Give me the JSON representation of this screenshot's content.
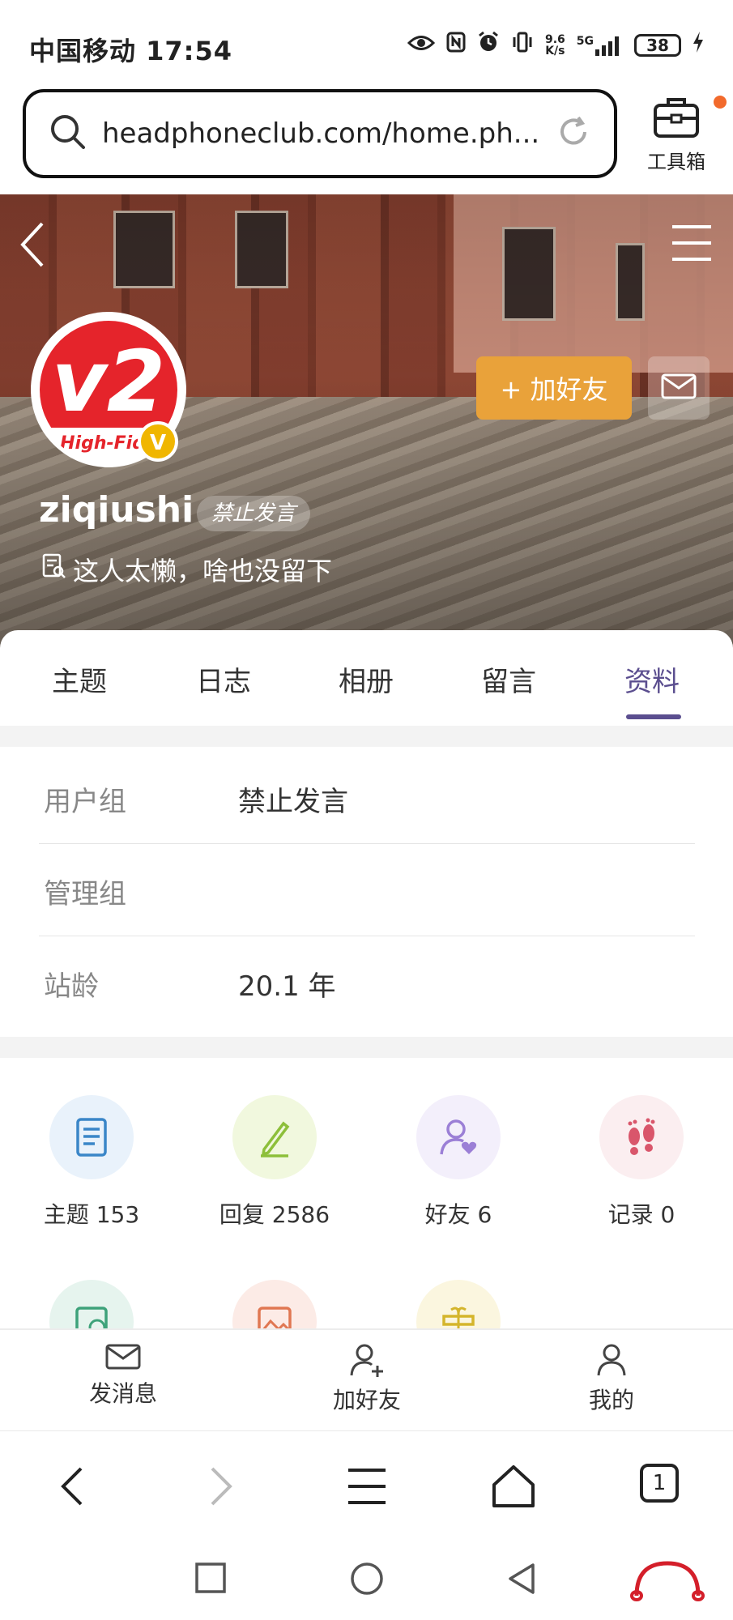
{
  "status_bar": {
    "carrier_time": "中国移动 17:54",
    "net_speed_top": "9.6",
    "net_speed_bottom": "K/s",
    "network": "5G",
    "battery": "38"
  },
  "url_bar": {
    "url": "headphoneclub.com/home.ph...",
    "toolbox_label": "工具箱"
  },
  "profile": {
    "avatar_text": "v2",
    "avatar_subtext": "High-Fide",
    "verified_badge": "V",
    "username": "ziqiushi",
    "status_badge": "禁止发言",
    "bio": "这人太懒，啥也没留下",
    "add_friend_label": "+ 加好友"
  },
  "tabs": [
    {
      "label": "主题",
      "active": false
    },
    {
      "label": "日志",
      "active": false
    },
    {
      "label": "相册",
      "active": false
    },
    {
      "label": "留言",
      "active": false
    },
    {
      "label": "资料",
      "active": true
    }
  ],
  "info": [
    {
      "label": "用户组",
      "value": "禁止发言"
    },
    {
      "label": "管理组",
      "value": ""
    },
    {
      "label": "站龄",
      "value": "20.1 年"
    }
  ],
  "stats": [
    {
      "label": "主题 153",
      "icon": "document-icon",
      "bg": "#e9f2fb",
      "color": "#3a86c8"
    },
    {
      "label": "回复 2586",
      "icon": "pencil-icon",
      "bg": "#f1f8de",
      "color": "#8dbf3a"
    },
    {
      "label": "好友 6",
      "icon": "friend-heart-icon",
      "bg": "#f3effb",
      "color": "#9b7fd6"
    },
    {
      "label": "记录 0",
      "icon": "footprints-icon",
      "bg": "#fbeef0",
      "color": "#d9566b"
    }
  ],
  "stats_row2": [
    {
      "icon": "calendar-clock-icon",
      "bg": "#e6f4ee",
      "color": "#3ea27a"
    },
    {
      "icon": "photo-icon",
      "bg": "#fcebe6",
      "color": "#e07752"
    },
    {
      "icon": "gift-icon",
      "bg": "#fbf6df",
      "color": "#d4b52c"
    }
  ],
  "action_bar": {
    "message": "发消息",
    "add_friend": "加好友",
    "mine": "我的"
  },
  "browser_nav": {
    "tab_count": "1"
  },
  "colors": {
    "accent": "#5b4e8f",
    "add_friend_button": "#e9a23a",
    "brand_red": "#e5242b"
  }
}
